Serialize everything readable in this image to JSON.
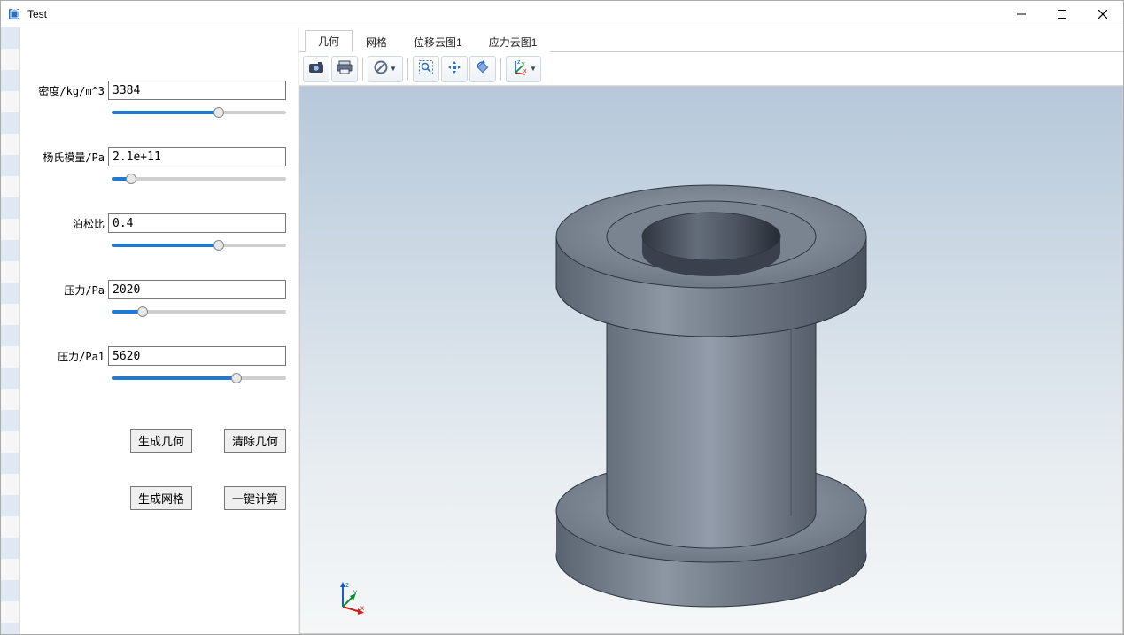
{
  "window": {
    "title": "Test"
  },
  "params": [
    {
      "label": "密度/kg/m^3",
      "value": "3384",
      "pos": 62
    },
    {
      "label": "杨氏模量/Pa",
      "value": "2.1e+11",
      "pos": 8
    },
    {
      "label": "泊松比",
      "value": "0.4",
      "pos": 62
    },
    {
      "label": "压力/Pa",
      "value": "2020",
      "pos": 15
    },
    {
      "label": "压力/Pa1",
      "value": "5620",
      "pos": 73
    }
  ],
  "buttons": {
    "gen_geom": "生成几何",
    "clear_geom": "清除几何",
    "gen_mesh": "生成网格",
    "one_calc": "一键计算"
  },
  "tabs": [
    {
      "label": "几何",
      "active": true
    },
    {
      "label": "网格",
      "active": false
    },
    {
      "label": "位移云图1",
      "active": false
    },
    {
      "label": "应力云图1",
      "active": false
    }
  ],
  "toolbar_icons": [
    "camera-icon",
    "print-icon",
    "sep",
    "no-entry-icon",
    "sep",
    "zoom-box-icon",
    "pan-icon",
    "rotate-icon",
    "sep",
    "axis-icon"
  ],
  "triad_axes": {
    "x": "x",
    "y": "y",
    "z": "z"
  }
}
